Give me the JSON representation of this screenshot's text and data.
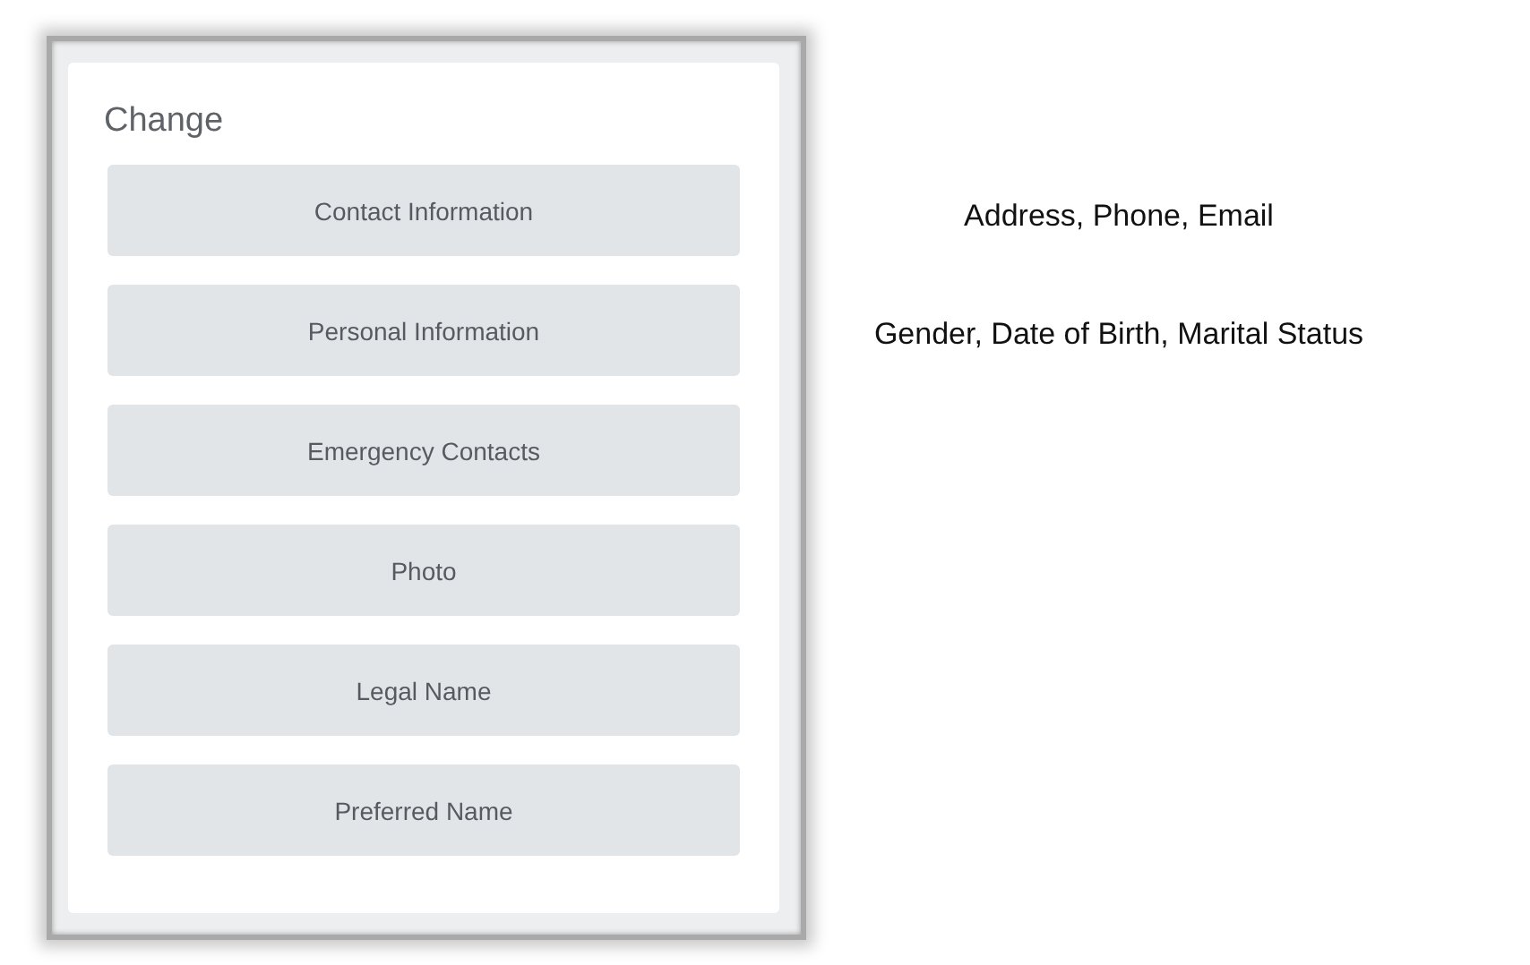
{
  "panel": {
    "title": "Change",
    "buttons": [
      {
        "label": "Contact Information"
      },
      {
        "label": "Personal Information"
      },
      {
        "label": "Emergency Contacts"
      },
      {
        "label": "Photo"
      },
      {
        "label": "Legal Name"
      },
      {
        "label": "Preferred Name"
      }
    ]
  },
  "notes": [
    {
      "text": "Address, Phone, Email"
    },
    {
      "text": "Gender, Date of Birth, Marital Status"
    }
  ]
}
